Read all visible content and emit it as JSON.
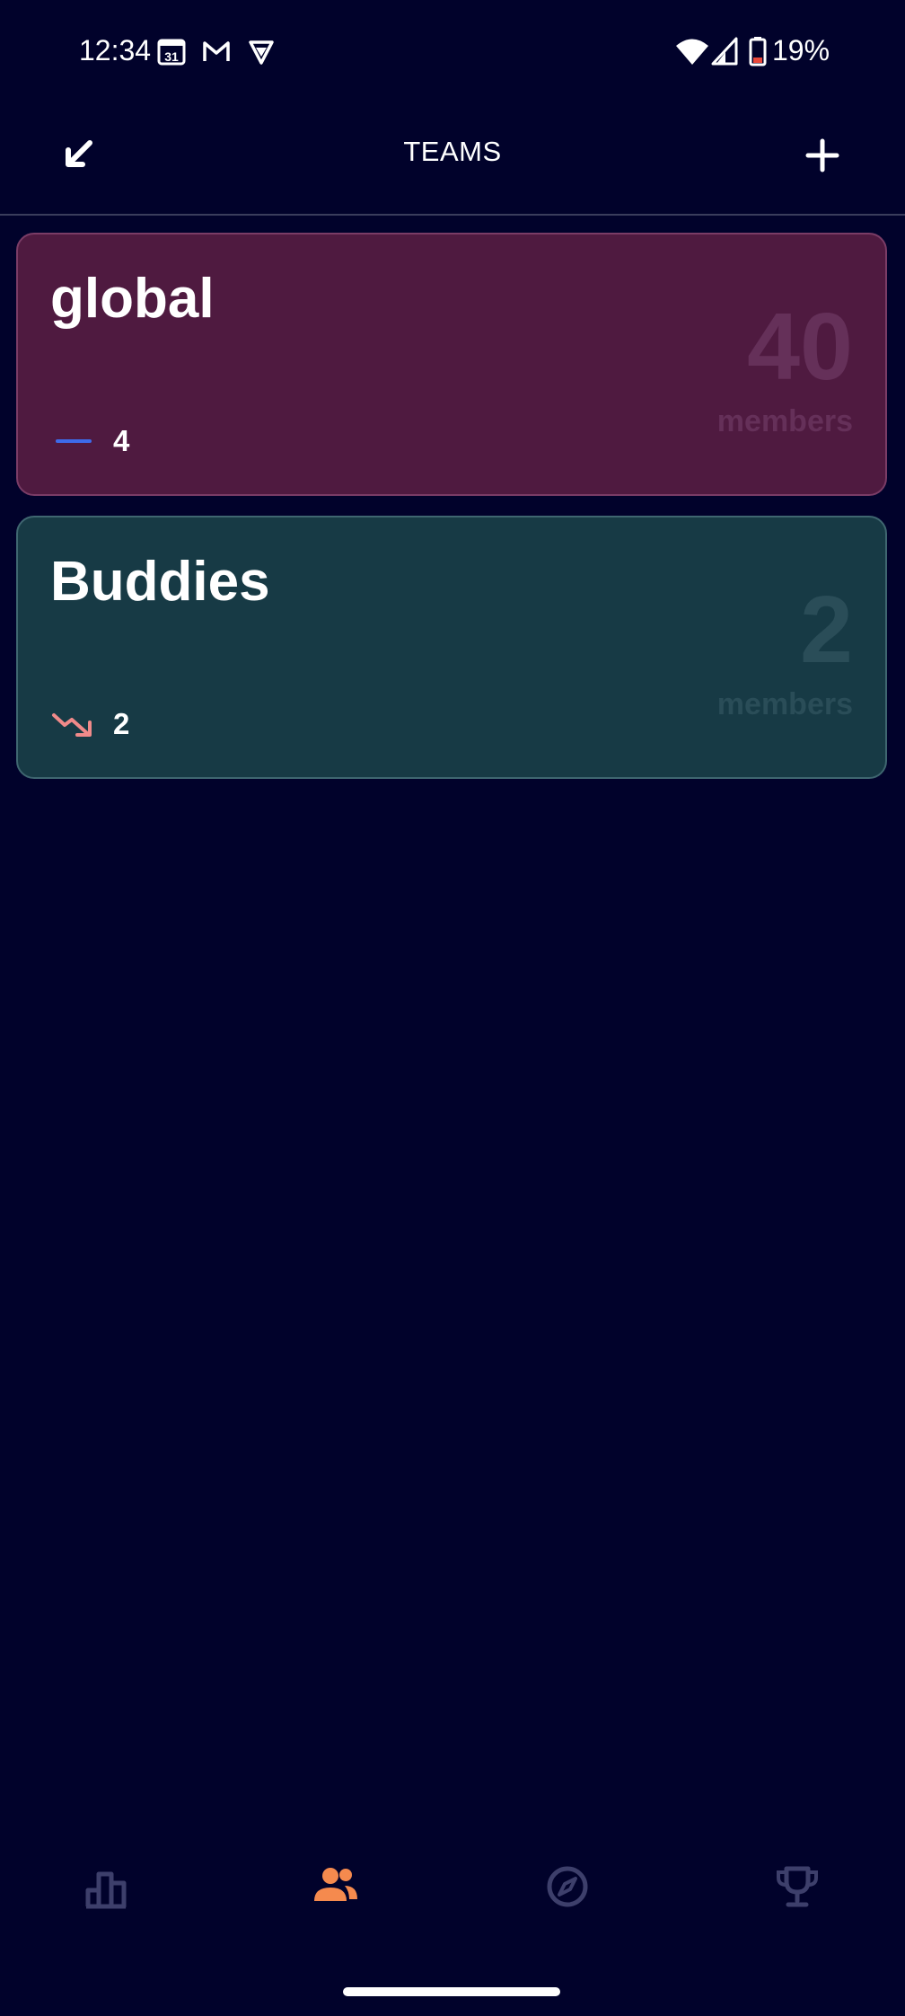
{
  "status_bar": {
    "time": "12:34",
    "calendar_badge": "31",
    "battery_percent": "19%"
  },
  "app_bar": {
    "title": "TEAMS"
  },
  "teams": [
    {
      "name": "global",
      "member_count": "40",
      "members_label": "members",
      "trend_value": "4",
      "trend_icon": "trend-flat-icon",
      "trend_color": "#3d6bea",
      "card_color": "#4f1a40"
    },
    {
      "name": "Buddies",
      "member_count": "2",
      "members_label": "members",
      "trend_value": "2",
      "trend_icon": "trend-down-icon",
      "trend_color": "#f08a8a",
      "card_color": "#173a45"
    }
  ],
  "bottom_nav": {
    "items": [
      {
        "icon": "leaderboard-icon",
        "active": false
      },
      {
        "icon": "teams-icon",
        "active": true
      },
      {
        "icon": "explore-icon",
        "active": false
      },
      {
        "icon": "trophy-icon",
        "active": false
      }
    ],
    "active_color": "#f58a4e",
    "inactive_color": "#3d3f6b"
  }
}
